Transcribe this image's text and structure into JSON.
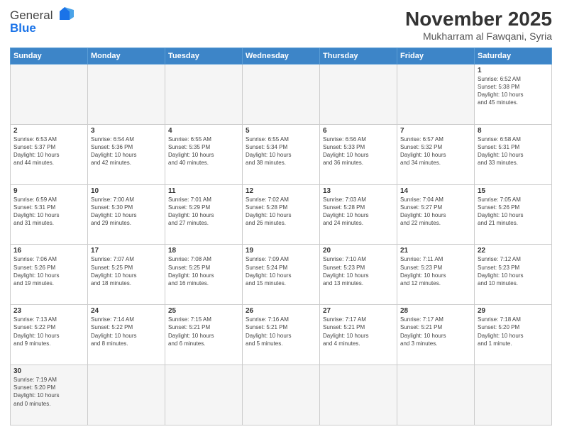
{
  "header": {
    "logo_general": "General",
    "logo_blue": "Blue",
    "month_title": "November 2025",
    "subtitle": "Mukharram al Fawqani, Syria"
  },
  "days_of_week": [
    "Sunday",
    "Monday",
    "Tuesday",
    "Wednesday",
    "Thursday",
    "Friday",
    "Saturday"
  ],
  "weeks": [
    [
      {
        "day": "",
        "info": "",
        "empty": true
      },
      {
        "day": "",
        "info": "",
        "empty": true
      },
      {
        "day": "",
        "info": "",
        "empty": true
      },
      {
        "day": "",
        "info": "",
        "empty": true
      },
      {
        "day": "",
        "info": "",
        "empty": true
      },
      {
        "day": "",
        "info": "",
        "empty": true
      },
      {
        "day": "1",
        "info": "Sunrise: 6:52 AM\nSunset: 5:38 PM\nDaylight: 10 hours\nand 45 minutes.",
        "empty": false
      }
    ],
    [
      {
        "day": "2",
        "info": "Sunrise: 6:53 AM\nSunset: 5:37 PM\nDaylight: 10 hours\nand 44 minutes.",
        "empty": false
      },
      {
        "day": "3",
        "info": "Sunrise: 6:54 AM\nSunset: 5:36 PM\nDaylight: 10 hours\nand 42 minutes.",
        "empty": false
      },
      {
        "day": "4",
        "info": "Sunrise: 6:55 AM\nSunset: 5:35 PM\nDaylight: 10 hours\nand 40 minutes.",
        "empty": false
      },
      {
        "day": "5",
        "info": "Sunrise: 6:55 AM\nSunset: 5:34 PM\nDaylight: 10 hours\nand 38 minutes.",
        "empty": false
      },
      {
        "day": "6",
        "info": "Sunrise: 6:56 AM\nSunset: 5:33 PM\nDaylight: 10 hours\nand 36 minutes.",
        "empty": false
      },
      {
        "day": "7",
        "info": "Sunrise: 6:57 AM\nSunset: 5:32 PM\nDaylight: 10 hours\nand 34 minutes.",
        "empty": false
      },
      {
        "day": "8",
        "info": "Sunrise: 6:58 AM\nSunset: 5:31 PM\nDaylight: 10 hours\nand 33 minutes.",
        "empty": false
      }
    ],
    [
      {
        "day": "9",
        "info": "Sunrise: 6:59 AM\nSunset: 5:31 PM\nDaylight: 10 hours\nand 31 minutes.",
        "empty": false
      },
      {
        "day": "10",
        "info": "Sunrise: 7:00 AM\nSunset: 5:30 PM\nDaylight: 10 hours\nand 29 minutes.",
        "empty": false
      },
      {
        "day": "11",
        "info": "Sunrise: 7:01 AM\nSunset: 5:29 PM\nDaylight: 10 hours\nand 27 minutes.",
        "empty": false
      },
      {
        "day": "12",
        "info": "Sunrise: 7:02 AM\nSunset: 5:28 PM\nDaylight: 10 hours\nand 26 minutes.",
        "empty": false
      },
      {
        "day": "13",
        "info": "Sunrise: 7:03 AM\nSunset: 5:28 PM\nDaylight: 10 hours\nand 24 minutes.",
        "empty": false
      },
      {
        "day": "14",
        "info": "Sunrise: 7:04 AM\nSunset: 5:27 PM\nDaylight: 10 hours\nand 22 minutes.",
        "empty": false
      },
      {
        "day": "15",
        "info": "Sunrise: 7:05 AM\nSunset: 5:26 PM\nDaylight: 10 hours\nand 21 minutes.",
        "empty": false
      }
    ],
    [
      {
        "day": "16",
        "info": "Sunrise: 7:06 AM\nSunset: 5:26 PM\nDaylight: 10 hours\nand 19 minutes.",
        "empty": false
      },
      {
        "day": "17",
        "info": "Sunrise: 7:07 AM\nSunset: 5:25 PM\nDaylight: 10 hours\nand 18 minutes.",
        "empty": false
      },
      {
        "day": "18",
        "info": "Sunrise: 7:08 AM\nSunset: 5:25 PM\nDaylight: 10 hours\nand 16 minutes.",
        "empty": false
      },
      {
        "day": "19",
        "info": "Sunrise: 7:09 AM\nSunset: 5:24 PM\nDaylight: 10 hours\nand 15 minutes.",
        "empty": false
      },
      {
        "day": "20",
        "info": "Sunrise: 7:10 AM\nSunset: 5:23 PM\nDaylight: 10 hours\nand 13 minutes.",
        "empty": false
      },
      {
        "day": "21",
        "info": "Sunrise: 7:11 AM\nSunset: 5:23 PM\nDaylight: 10 hours\nand 12 minutes.",
        "empty": false
      },
      {
        "day": "22",
        "info": "Sunrise: 7:12 AM\nSunset: 5:23 PM\nDaylight: 10 hours\nand 10 minutes.",
        "empty": false
      }
    ],
    [
      {
        "day": "23",
        "info": "Sunrise: 7:13 AM\nSunset: 5:22 PM\nDaylight: 10 hours\nand 9 minutes.",
        "empty": false
      },
      {
        "day": "24",
        "info": "Sunrise: 7:14 AM\nSunset: 5:22 PM\nDaylight: 10 hours\nand 8 minutes.",
        "empty": false
      },
      {
        "day": "25",
        "info": "Sunrise: 7:15 AM\nSunset: 5:21 PM\nDaylight: 10 hours\nand 6 minutes.",
        "empty": false
      },
      {
        "day": "26",
        "info": "Sunrise: 7:16 AM\nSunset: 5:21 PM\nDaylight: 10 hours\nand 5 minutes.",
        "empty": false
      },
      {
        "day": "27",
        "info": "Sunrise: 7:17 AM\nSunset: 5:21 PM\nDaylight: 10 hours\nand 4 minutes.",
        "empty": false
      },
      {
        "day": "28",
        "info": "Sunrise: 7:17 AM\nSunset: 5:21 PM\nDaylight: 10 hours\nand 3 minutes.",
        "empty": false
      },
      {
        "day": "29",
        "info": "Sunrise: 7:18 AM\nSunset: 5:20 PM\nDaylight: 10 hours\nand 1 minute.",
        "empty": false
      }
    ],
    [
      {
        "day": "30",
        "info": "Sunrise: 7:19 AM\nSunset: 5:20 PM\nDaylight: 10 hours\nand 0 minutes.",
        "empty": false,
        "last": true
      },
      {
        "day": "",
        "info": "",
        "empty": true,
        "last": true
      },
      {
        "day": "",
        "info": "",
        "empty": true,
        "last": true
      },
      {
        "day": "",
        "info": "",
        "empty": true,
        "last": true
      },
      {
        "day": "",
        "info": "",
        "empty": true,
        "last": true
      },
      {
        "day": "",
        "info": "",
        "empty": true,
        "last": true
      },
      {
        "day": "",
        "info": "",
        "empty": true,
        "last": true
      }
    ]
  ]
}
